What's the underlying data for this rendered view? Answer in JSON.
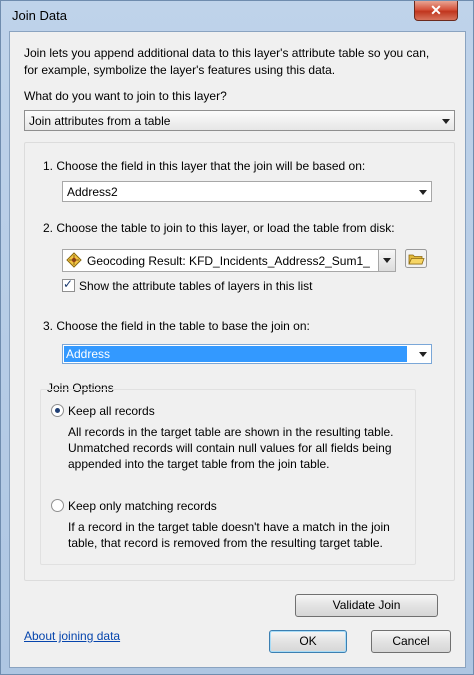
{
  "window": {
    "title": "Join Data",
    "close_glyph": "✕"
  },
  "intro": {
    "line1": "Join lets you append additional data to this layer's attribute table so you can,",
    "line2": "for example, symbolize the layer's features using this data."
  },
  "join_type": {
    "question": "What do you want to join to this layer?",
    "value": "Join attributes from a table"
  },
  "step1": {
    "label": "1.  Choose the field in this layer that the join will be based on:",
    "value": "Address2"
  },
  "step2": {
    "label": "2.  Choose the table to join to this layer, or load the table from disk:",
    "value": "Geocoding Result: KFD_Incidents_Address2_Sum1_",
    "show_tables_label": "Show the attribute tables of layers in this list",
    "show_tables_checked": true
  },
  "step3": {
    "label": "3.  Choose the field in the table to base the join on:",
    "value": "Address"
  },
  "join_options": {
    "title": "Join Options",
    "keep_all": {
      "label": "Keep all records",
      "selected": true,
      "desc1": "All records in the target table are shown in the resulting table.",
      "desc2": "Unmatched records will contain null values for all fields being",
      "desc3": "appended into the target table from the join table."
    },
    "keep_matching": {
      "label": "Keep only matching records",
      "selected": false,
      "desc1": "If a record in the target table doesn't have a match in the join",
      "desc2": "table, that record is removed from the resulting target table."
    }
  },
  "buttons": {
    "validate": "Validate Join",
    "about_link": "About joining data",
    "ok": "OK",
    "cancel": "Cancel"
  },
  "colors": {
    "selection": "#3399ff",
    "link": "#0645ad",
    "dialog_bg": "#f0f0f0"
  }
}
